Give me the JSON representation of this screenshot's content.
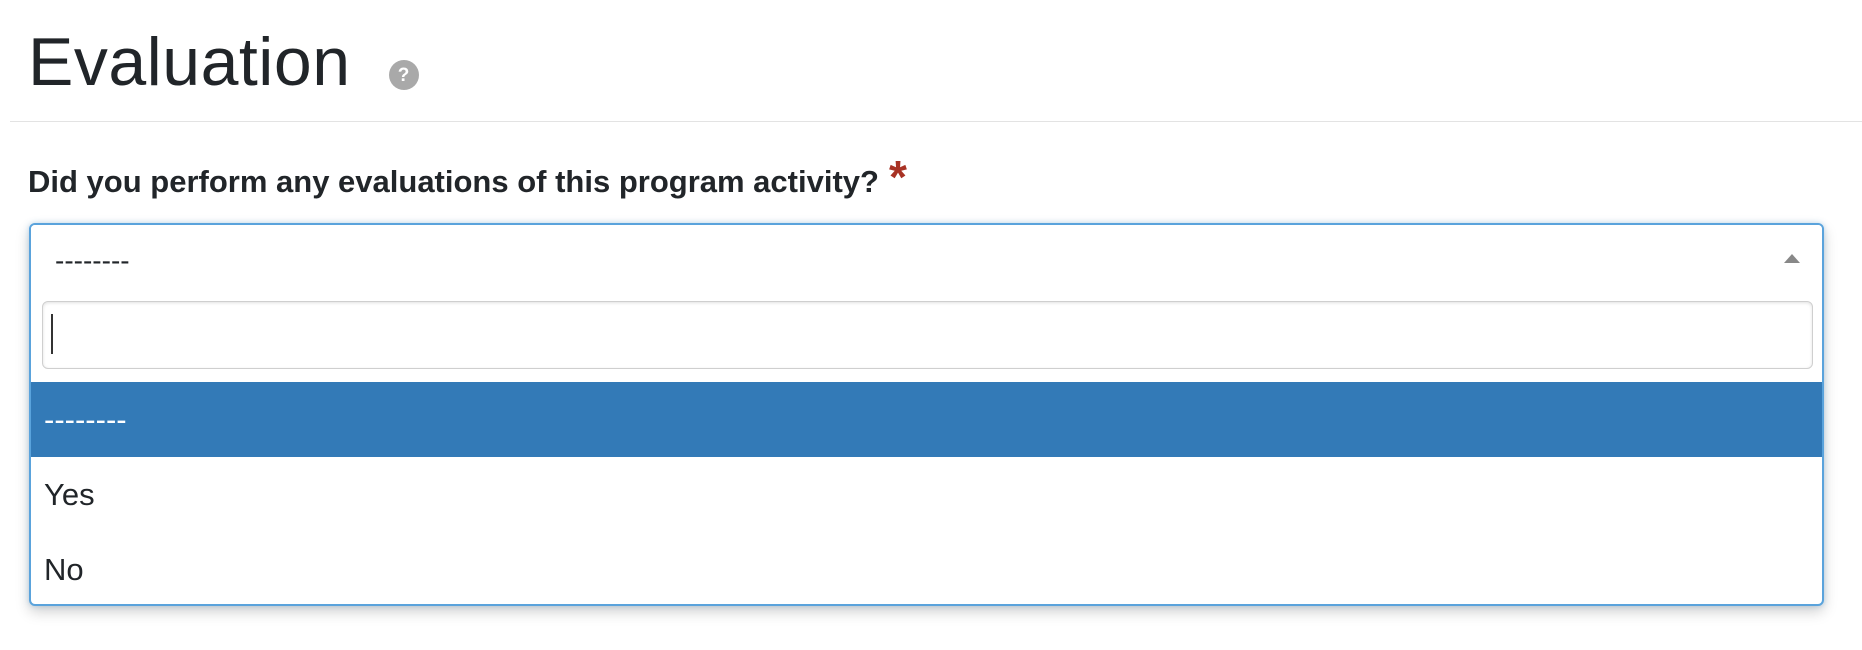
{
  "header": {
    "title": "Evaluation",
    "help_icon_glyph": "?"
  },
  "question": {
    "label": "Did you perform any evaluations of this program activity?",
    "required_mark": "*"
  },
  "select": {
    "current_value": "--------",
    "search_value": "",
    "options": [
      {
        "label": "--------",
        "highlighted": true
      },
      {
        "label": "Yes",
        "highlighted": false
      },
      {
        "label": "No",
        "highlighted": false
      }
    ]
  },
  "colors": {
    "accent_border": "#5aa3dc",
    "highlight": "#337ab7",
    "required": "#a83224"
  },
  "icons": {
    "help": "help-icon",
    "caret": "caret-up-icon"
  }
}
